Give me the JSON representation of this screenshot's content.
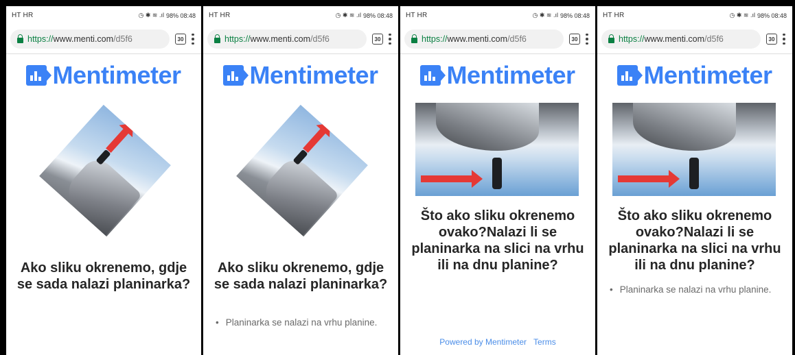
{
  "panels": [
    {
      "status_left": "HT HR",
      "status_right": "98% 08:48",
      "url": {
        "scheme": "https://",
        "host": "www.menti.com",
        "path": "/d5f6"
      },
      "tab_count": "30",
      "logo_text": "Mentimeter",
      "question": "Ako sliku okrenemo, gdje se sada nalazi planinarka?",
      "bullet": ""
    },
    {
      "status_left": "HT HR",
      "status_right": "98% 08:48",
      "url": {
        "scheme": "https://",
        "host": "www.menti.com",
        "path": "/d5f6"
      },
      "tab_count": "30",
      "logo_text": "Mentimeter",
      "question": "Ako sliku okrenemo, gdje se sada nalazi planinarka?",
      "bullet": "Planinarka se nalazi na vrhu planine."
    },
    {
      "status_left": "HT HR",
      "status_right": "98% 08:48",
      "url": {
        "scheme": "https://",
        "host": "www.menti.com",
        "path": "/d5f6"
      },
      "tab_count": "30",
      "logo_text": "Mentimeter",
      "question": "Što ako sliku okrenemo ovako?Nalazi li se planinarka na slici na vrhu ili na dnu planine?",
      "bullet": "",
      "footer_powered": "Powered by Mentimeter",
      "footer_terms": "Terms"
    },
    {
      "status_left": "HT HR",
      "status_right": "98% 08:48",
      "url": {
        "scheme": "https://",
        "host": "www.menti.com",
        "path": "/d5f6"
      },
      "tab_count": "30",
      "logo_text": "Mentimeter",
      "question": "Što ako sliku okrenemo ovako?Nalazi li se planinarka na slici na vrhu ili na dnu planine?",
      "bullet": "Planinarka se nalazi na vrhu planine."
    }
  ],
  "colors": {
    "brand": "#3b82f6",
    "arrow": "#e53935",
    "secure": "#0b8043"
  },
  "icons": [
    "lock-icon",
    "tab-count-icon",
    "menu-kebab-icon",
    "mentimeter-logo-icon"
  ]
}
